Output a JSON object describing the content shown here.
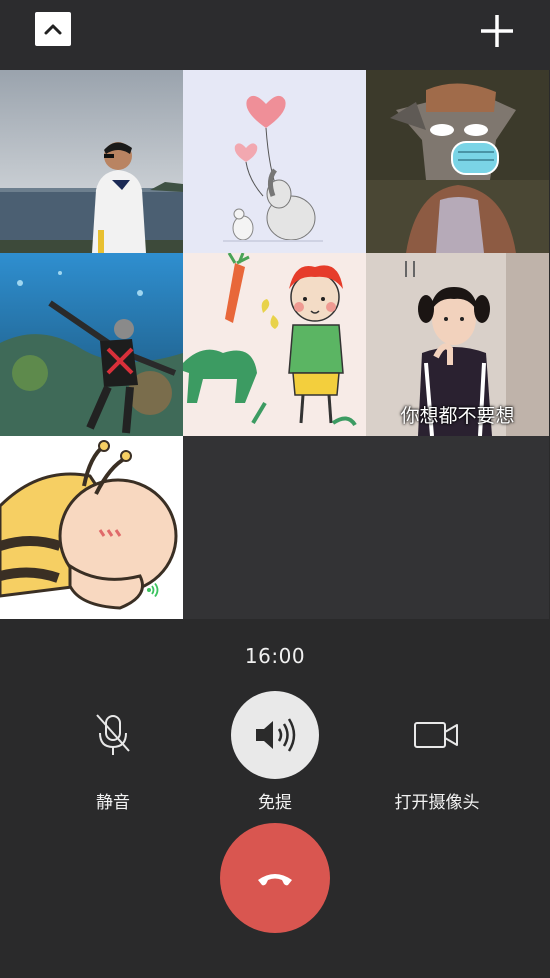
{
  "call": {
    "duration": "16:00"
  },
  "controls": {
    "mute_label": "静音",
    "speaker_label": "免提",
    "camera_label": "打开摄像头"
  },
  "icons": {
    "collapse": "chevron-up-icon",
    "add": "plus-icon",
    "mute": "microphone-off-icon",
    "speaker": "speaker-icon",
    "camera": "video-camera-icon",
    "hangup": "phone-hangup-icon"
  },
  "participants": [
    {
      "kind": "photo-man-seaside"
    },
    {
      "kind": "illustration-elephant-balloons"
    },
    {
      "kind": "cartoon-wolf-mask"
    },
    {
      "kind": "photo-aquarium"
    },
    {
      "kind": "illustration-doodle-boy"
    },
    {
      "kind": "photo-girl-meme",
      "caption": "你想都不要想"
    },
    {
      "kind": "cartoon-bee",
      "speaking": true
    }
  ],
  "colors": {
    "background": "#2a2a2b",
    "hangup": "#d95650",
    "speaker_active": "#e9e9e9",
    "speaking_indicator": "#3cc35f"
  }
}
